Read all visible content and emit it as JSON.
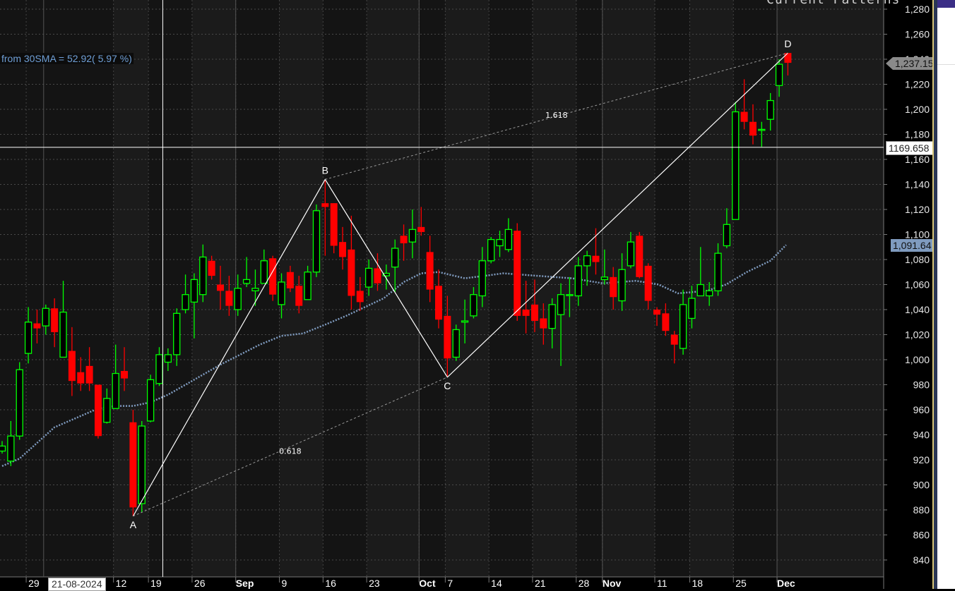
{
  "header": {
    "title": "Current Patterns",
    "sma_info": "from 30SMA = 52.92( 5.97 %)"
  },
  "crosshair": {
    "date": "21-08-2024",
    "price": "1169.658",
    "index": 18.4,
    "value": 1169.658
  },
  "tags": {
    "last_price": "1,237.15",
    "sma_value": "1,091.64"
  },
  "colors": {
    "up": "#00ff00",
    "down": "#ff0000",
    "sma": "#7f9bbf",
    "pattern": "#ffffff"
  },
  "chart_data": {
    "type": "candlestick",
    "title": "Current Patterns",
    "ylim": [
      830,
      1290
    ],
    "y_ticks": [
      "840",
      "860",
      "880",
      "900",
      "920",
      "940",
      "960",
      "980",
      "1,000",
      "1,020",
      "1,040",
      "1,060",
      "1,080",
      "1,100",
      "1,120",
      "1,140",
      "1,160",
      "1,180",
      "1,200",
      "1,220",
      "1,240",
      "1,260",
      "1,280"
    ],
    "x_ticks": [
      {
        "label": "29",
        "i": 3,
        "bold": false
      },
      {
        "label": "12",
        "i": 13,
        "bold": false
      },
      {
        "label": "19",
        "i": 17,
        "bold": false
      },
      {
        "label": "26",
        "i": 22,
        "bold": false
      },
      {
        "label": "Sep",
        "i": 27,
        "bold": true
      },
      {
        "label": "9",
        "i": 32,
        "bold": false
      },
      {
        "label": "16",
        "i": 37,
        "bold": false
      },
      {
        "label": "23",
        "i": 42,
        "bold": false
      },
      {
        "label": "Oct",
        "i": 48,
        "bold": true
      },
      {
        "label": "7",
        "i": 51,
        "bold": false
      },
      {
        "label": "14",
        "i": 56,
        "bold": false
      },
      {
        "label": "21",
        "i": 61,
        "bold": false
      },
      {
        "label": "28",
        "i": 66,
        "bold": false
      },
      {
        "label": "Nov",
        "i": 69,
        "bold": true
      },
      {
        "label": "11",
        "i": 75,
        "bold": false
      },
      {
        "label": "18",
        "i": 79,
        "bold": false
      },
      {
        "label": "25",
        "i": 84,
        "bold": false
      },
      {
        "label": "Dec",
        "i": 89,
        "bold": true
      }
    ],
    "month_starts": [
      5,
      27,
      48,
      69,
      89
    ],
    "ohlc": [
      [
        927,
        935,
        925,
        931
      ],
      [
        919,
        951,
        915,
        939
      ],
      [
        939,
        998,
        936,
        992
      ],
      [
        1005,
        1042,
        997,
        1030
      ],
      [
        1029,
        1040,
        1013,
        1025
      ],
      [
        1027,
        1044,
        1020,
        1041
      ],
      [
        1041,
        1049,
        1010,
        1022
      ],
      [
        1002,
        1063,
        1002,
        1038
      ],
      [
        1007,
        1026,
        971,
        983
      ],
      [
        990,
        1002,
        975,
        981
      ],
      [
        995,
        1010,
        975,
        981
      ],
      [
        980,
        980,
        937,
        939
      ],
      [
        950,
        977,
        949,
        969
      ],
      [
        961,
        1012,
        961,
        989
      ],
      [
        991,
        1010,
        975,
        985
      ],
      [
        950,
        960,
        875,
        882
      ],
      [
        885,
        951,
        878,
        947
      ],
      [
        951,
        988,
        950,
        984
      ],
      [
        981,
        1010,
        979,
        1004
      ],
      [
        998,
        1009,
        991,
        1004
      ],
      [
        1004,
        1041,
        995,
        1037
      ],
      [
        1040,
        1068,
        1037,
        1052
      ],
      [
        1046,
        1069,
        1017,
        1064
      ],
      [
        1052,
        1092,
        1046,
        1082
      ],
      [
        1079,
        1083,
        1064,
        1067
      ],
      [
        1060,
        1075,
        1040,
        1055
      ],
      [
        1055,
        1067,
        1035,
        1043
      ],
      [
        1040,
        1068,
        1035,
        1057
      ],
      [
        1061,
        1082,
        1058,
        1064
      ],
      [
        1055,
        1072,
        1043,
        1057
      ],
      [
        1061,
        1088,
        1061,
        1079
      ],
      [
        1081,
        1083,
        1047,
        1052
      ],
      [
        1044,
        1069,
        1033,
        1062
      ],
      [
        1070,
        1075,
        1054,
        1057
      ],
      [
        1059,
        1067,
        1037,
        1043
      ],
      [
        1048,
        1075,
        1048,
        1070
      ],
      [
        1070,
        1124,
        1066,
        1119
      ],
      [
        1125,
        1144,
        1083,
        1122
      ],
      [
        1125,
        1125,
        1085,
        1091
      ],
      [
        1094,
        1106,
        1072,
        1082
      ],
      [
        1088,
        1115,
        1040,
        1051
      ],
      [
        1055,
        1066,
        1039,
        1046
      ],
      [
        1058,
        1080,
        1051,
        1073
      ],
      [
        1073,
        1085,
        1055,
        1061
      ],
      [
        1067,
        1076,
        1056,
        1069
      ],
      [
        1074,
        1096,
        1054,
        1089
      ],
      [
        1099,
        1108,
        1079,
        1093
      ],
      [
        1094,
        1120,
        1081,
        1104
      ],
      [
        1106,
        1122,
        1099,
        1102
      ],
      [
        1086,
        1099,
        1046,
        1056
      ],
      [
        1059,
        1072,
        1025,
        1032
      ],
      [
        1035,
        1051,
        986,
        1001
      ],
      [
        1002,
        1028,
        999,
        1024
      ],
      [
        1030,
        1048,
        1013,
        1031
      ],
      [
        1035,
        1058,
        1033,
        1052
      ],
      [
        1051,
        1090,
        1042,
        1079
      ],
      [
        1079,
        1098,
        1077,
        1096
      ],
      [
        1091,
        1103,
        1082,
        1096
      ],
      [
        1088,
        1113,
        1086,
        1104
      ],
      [
        1103,
        1109,
        1031,
        1035
      ],
      [
        1040,
        1063,
        1021,
        1035
      ],
      [
        1044,
        1064,
        1022,
        1031
      ],
      [
        1033,
        1045,
        1012,
        1025
      ],
      [
        1025,
        1049,
        1009,
        1044
      ],
      [
        1036,
        1061,
        995,
        1052
      ],
      [
        1052,
        1066,
        1034,
        1052
      ],
      [
        1051,
        1082,
        1043,
        1075
      ],
      [
        1075,
        1087,
        1059,
        1083
      ],
      [
        1083,
        1105,
        1068,
        1078
      ],
      [
        1064,
        1088,
        1060,
        1066
      ],
      [
        1066,
        1074,
        1040,
        1050
      ],
      [
        1047,
        1085,
        1039,
        1072
      ],
      [
        1075,
        1102,
        1073,
        1094
      ],
      [
        1099,
        1102,
        1065,
        1066
      ],
      [
        1075,
        1077,
        1040,
        1047
      ],
      [
        1040,
        1042,
        1027,
        1036
      ],
      [
        1037,
        1045,
        1019,
        1023
      ],
      [
        1020,
        1023,
        997,
        1012
      ],
      [
        1009,
        1056,
        1004,
        1044
      ],
      [
        1033,
        1059,
        1025,
        1049
      ],
      [
        1051,
        1090,
        1051,
        1060
      ],
      [
        1051,
        1062,
        1043,
        1055
      ],
      [
        1055,
        1093,
        1051,
        1085
      ],
      [
        1091,
        1121,
        1089,
        1108
      ],
      [
        1112,
        1206,
        1112,
        1198
      ],
      [
        1198,
        1224,
        1184,
        1190
      ],
      [
        1190,
        1204,
        1172,
        1179
      ],
      [
        1184,
        1190,
        1170,
        1184
      ],
      [
        1192,
        1213,
        1183,
        1207
      ],
      [
        1219,
        1240,
        1210,
        1236
      ],
      [
        1245,
        1245,
        1227,
        1237.15
      ]
    ],
    "sma30": [
      [
        0,
        915
      ],
      [
        2,
        921
      ],
      [
        6,
        946
      ],
      [
        11,
        961
      ],
      [
        13,
        963
      ],
      [
        15,
        963
      ],
      [
        17,
        966
      ],
      [
        19,
        972
      ],
      [
        21,
        980
      ],
      [
        25,
        996
      ],
      [
        29.5,
        1012
      ],
      [
        32,
        1019
      ],
      [
        34.5,
        1021
      ],
      [
        37,
        1028
      ],
      [
        39.4,
        1035
      ],
      [
        43.7,
        1049
      ],
      [
        46,
        1062
      ],
      [
        48,
        1069
      ],
      [
        50,
        1070
      ],
      [
        53,
        1065
      ],
      [
        55.3,
        1067
      ],
      [
        57.4,
        1069
      ],
      [
        61.3,
        1067
      ],
      [
        65.3,
        1065
      ],
      [
        68.8,
        1061
      ],
      [
        72.6,
        1063
      ],
      [
        75.2,
        1060
      ],
      [
        77.4,
        1053
      ],
      [
        80.7,
        1055
      ],
      [
        82.9,
        1060
      ],
      [
        85.3,
        1070
      ],
      [
        88,
        1079
      ],
      [
        89.8,
        1091.64
      ]
    ],
    "pattern": {
      "points": [
        {
          "label": "A",
          "i": 15,
          "v": 875
        },
        {
          "label": "B",
          "i": 37,
          "v": 1144
        },
        {
          "label": "C",
          "i": 51,
          "v": 986
        },
        {
          "label": "D",
          "i": 90,
          "v": 1245
        }
      ],
      "ratios": [
        {
          "label": "0.618",
          "from": "A",
          "to": "C"
        },
        {
          "label": "1.618",
          "from": "B",
          "to": "D"
        }
      ]
    }
  }
}
